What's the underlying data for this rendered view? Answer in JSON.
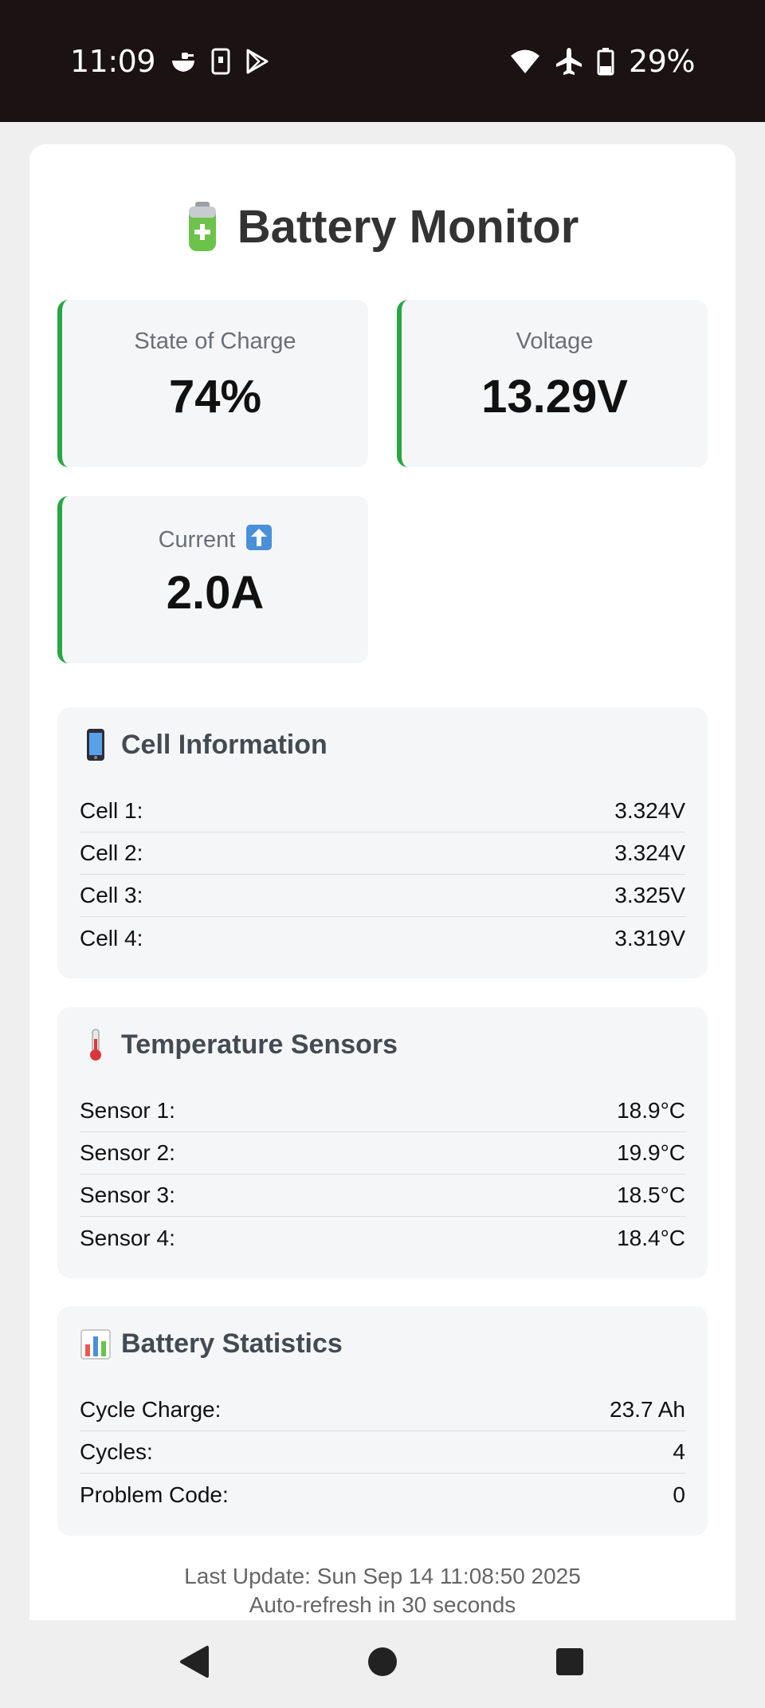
{
  "status_bar": {
    "time": "11:09",
    "battery_percent": "29%",
    "left_icons": [
      "cloud-icon",
      "phone-icon",
      "play-store-icon"
    ],
    "right_icons": [
      "wifi-icon",
      "airplane-icon",
      "battery-icon"
    ]
  },
  "app": {
    "title": "Battery Monitor",
    "title_icon": "battery-icon",
    "accent_color": "#28a745"
  },
  "metrics": {
    "soc": {
      "label": "State of Charge",
      "value": "74%"
    },
    "voltage": {
      "label": "Voltage",
      "value": "13.29V"
    },
    "current": {
      "label": "Current",
      "value": "2.0A",
      "direction_icon": "arrow-up-icon"
    }
  },
  "cell_info": {
    "heading": "Cell Information",
    "icon": "mobile-phone-icon",
    "rows": [
      {
        "label": "Cell 1:",
        "value": "3.324V"
      },
      {
        "label": "Cell 2:",
        "value": "3.324V"
      },
      {
        "label": "Cell 3:",
        "value": "3.325V"
      },
      {
        "label": "Cell 4:",
        "value": "3.319V"
      }
    ]
  },
  "temperature": {
    "heading": "Temperature Sensors",
    "icon": "thermometer-icon",
    "rows": [
      {
        "label": "Sensor 1:",
        "value": "18.9°C"
      },
      {
        "label": "Sensor 2:",
        "value": "19.9°C"
      },
      {
        "label": "Sensor 3:",
        "value": "18.5°C"
      },
      {
        "label": "Sensor 4:",
        "value": "18.4°C"
      }
    ]
  },
  "statistics": {
    "heading": "Battery Statistics",
    "icon": "bar-chart-icon",
    "rows": [
      {
        "label": "Cycle Charge:",
        "value": "23.7 Ah"
      },
      {
        "label": "Cycles:",
        "value": "4"
      },
      {
        "label": "Problem Code:",
        "value": "0"
      }
    ]
  },
  "footer": {
    "last_update": "Last Update: Sun Sep 14 11:08:50 2025",
    "refresh": "Auto-refresh in 30 seconds"
  },
  "nav_bar": {
    "buttons": [
      "back-icon",
      "home-icon",
      "recents-icon"
    ]
  }
}
